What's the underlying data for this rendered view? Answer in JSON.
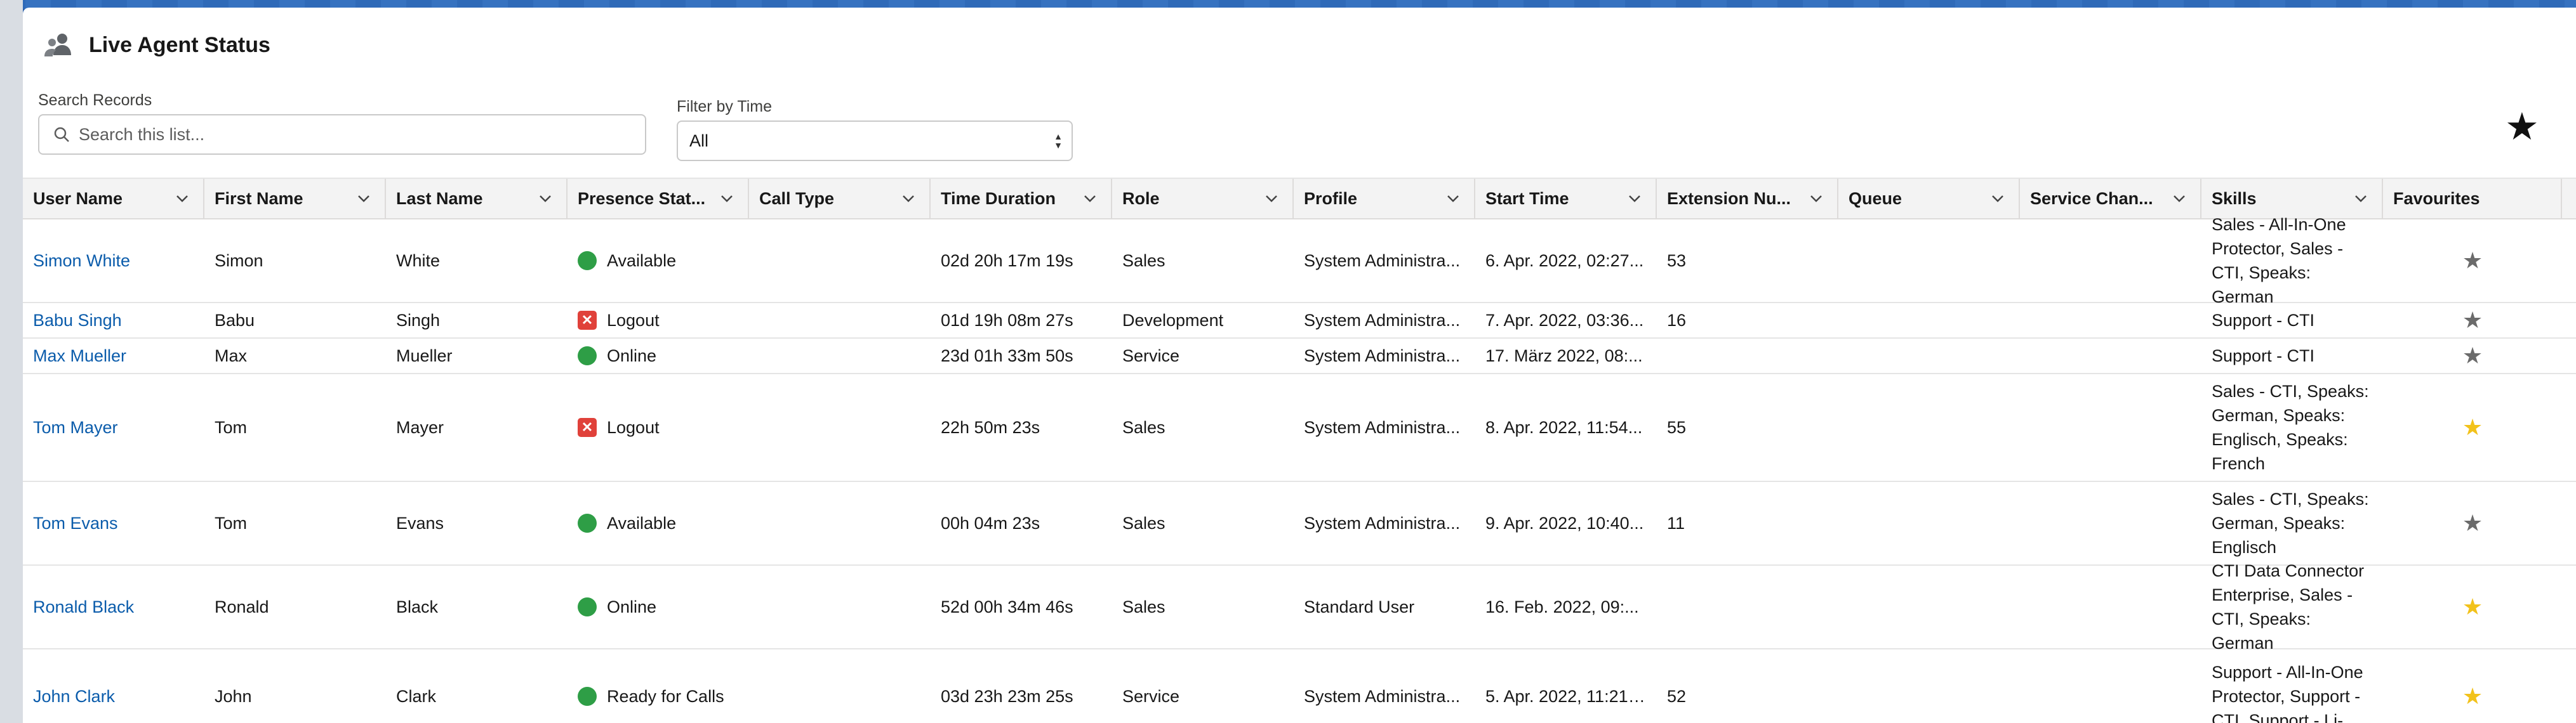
{
  "header": {
    "title": "Live Agent Status"
  },
  "search": {
    "label": "Search Records",
    "placeholder": "Search this list..."
  },
  "filter": {
    "label": "Filter by Time",
    "value": "All"
  },
  "columns": [
    {
      "label": "User Name"
    },
    {
      "label": "First Name"
    },
    {
      "label": "Last Name"
    },
    {
      "label": "Presence Stat..."
    },
    {
      "label": "Call Type"
    },
    {
      "label": "Time Duration"
    },
    {
      "label": "Role"
    },
    {
      "label": "Profile"
    },
    {
      "label": "Start Time"
    },
    {
      "label": "Extension Nu..."
    },
    {
      "label": "Queue"
    },
    {
      "label": "Service Chan..."
    },
    {
      "label": "Skills"
    },
    {
      "label": "Favourites"
    }
  ],
  "rows": [
    {
      "user": "Simon White",
      "first": "Simon",
      "last": "White",
      "status": "Available",
      "status_kind": "ok",
      "call_type": "",
      "duration": "02d 20h 17m 19s",
      "role": "Sales",
      "profile": "System Administra...",
      "start": "6. Apr. 2022, 02:27...",
      "ext": "53",
      "queue": "",
      "service": "",
      "skills": "Sales - All-In-One Protector, Sales - CTI, Speaks: German",
      "favourite": false
    },
    {
      "user": "Babu Singh",
      "first": "Babu",
      "last": "Singh",
      "status": "Logout",
      "status_kind": "off",
      "call_type": "",
      "duration": "01d 19h 08m 27s",
      "role": "Development",
      "profile": "System Administra...",
      "start": "7. Apr. 2022, 03:36...",
      "ext": "16",
      "queue": "",
      "service": "",
      "skills": "Support - CTI",
      "favourite": false
    },
    {
      "user": "Max Mueller",
      "first": "Max",
      "last": "Mueller",
      "status": "Online",
      "status_kind": "ok",
      "call_type": "",
      "duration": "23d 01h 33m 50s",
      "role": "Service",
      "profile": "System Administra...",
      "start": "17. März 2022, 08:...",
      "ext": "",
      "queue": "",
      "service": "",
      "skills": "Support - CTI",
      "favourite": false
    },
    {
      "user": "Tom Mayer",
      "first": "Tom",
      "last": "Mayer",
      "status": "Logout",
      "status_kind": "off",
      "call_type": "",
      "duration": "22h 50m 23s",
      "role": "Sales",
      "profile": "System Administra...",
      "start": "8. Apr. 2022, 11:54...",
      "ext": "55",
      "queue": "",
      "service": "",
      "skills": "Sales - CTI, Speaks: German, Speaks: Englisch, Speaks: French",
      "favourite": true
    },
    {
      "user": "Tom Evans",
      "first": "Tom",
      "last": "Evans",
      "status": "Available",
      "status_kind": "ok",
      "call_type": "",
      "duration": "00h 04m 23s",
      "role": "Sales",
      "profile": "System Administra...",
      "start": "9. Apr. 2022, 10:40...",
      "ext": "11",
      "queue": "",
      "service": "",
      "skills": "Sales - CTI, Speaks: German, Speaks: Englisch",
      "favourite": false
    },
    {
      "user": "Ronald Black",
      "first": "Ronald",
      "last": "Black",
      "status": "Online",
      "status_kind": "ok",
      "call_type": "",
      "duration": "52d 00h 34m 46s",
      "role": "Sales",
      "profile": "Standard User",
      "start": "16. Feb. 2022, 09:...",
      "ext": "",
      "queue": "",
      "service": "",
      "skills": "CTI Data Connector Enterprise, Sales - CTI, Speaks: German",
      "favourite": true
    },
    {
      "user": "John Clark",
      "first": "John",
      "last": "Clark",
      "status": "Ready for Calls",
      "status_kind": "ok",
      "call_type": "",
      "duration": "03d 23h 23m 25s",
      "role": "Service",
      "profile": "System Administra...",
      "start": "5. Apr. 2022, 11:21 ...",
      "ext": "52",
      "queue": "",
      "service": "",
      "skills": "Support - All-In-One Protector, Support - CTI, Support - Li-",
      "favourite": true
    }
  ],
  "colors": {
    "link": "#0b5cab",
    "online": "#2e9e46",
    "logout": "#e0413a",
    "fav_on": "#f2c21b",
    "fav_off": "#6b6b6b"
  },
  "icons": {
    "header": "users-icon",
    "search": "search-icon",
    "favourite": "star-icon",
    "sort": "chevron-down-icon"
  }
}
